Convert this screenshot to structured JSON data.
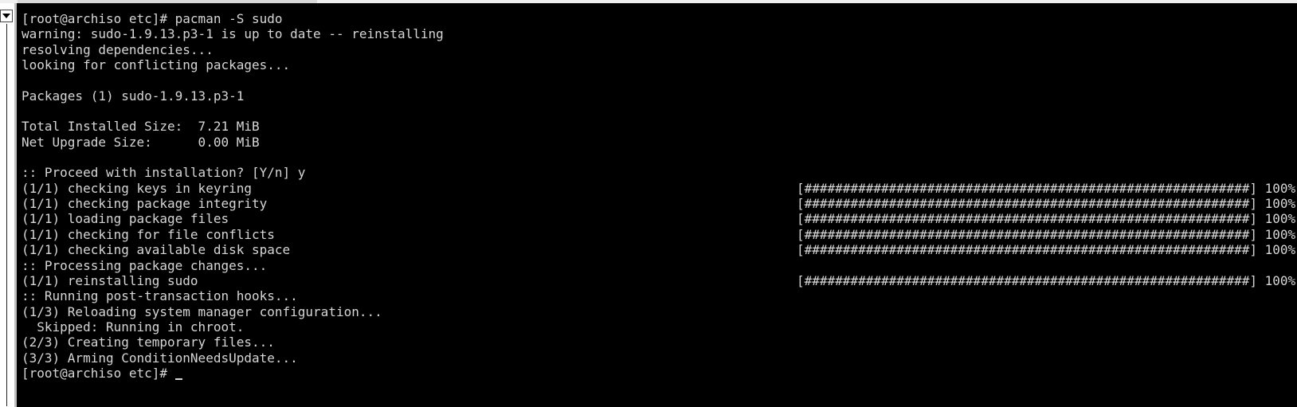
{
  "terminal": {
    "lines": [
      {
        "text": "[root@archiso etc]# pacman -S sudo",
        "bar": ""
      },
      {
        "text": "warning: sudo-1.9.13.p3-1 is up to date -- reinstalling",
        "bar": ""
      },
      {
        "text": "resolving dependencies...",
        "bar": ""
      },
      {
        "text": "looking for conflicting packages...",
        "bar": ""
      },
      {
        "text": "",
        "bar": ""
      },
      {
        "text": "Packages (1) sudo-1.9.13.p3-1",
        "bar": ""
      },
      {
        "text": "",
        "bar": ""
      },
      {
        "text": "Total Installed Size:  7.21 MiB",
        "bar": ""
      },
      {
        "text": "Net Upgrade Size:      0.00 MiB",
        "bar": ""
      },
      {
        "text": "",
        "bar": ""
      },
      {
        "text": ":: Proceed with installation? [Y/n] y",
        "bar": ""
      },
      {
        "text": "(1/1) checking keys in keyring",
        "bar": "[##########################################################] 100%"
      },
      {
        "text": "(1/1) checking package integrity",
        "bar": "[##########################################################] 100%"
      },
      {
        "text": "(1/1) loading package files",
        "bar": "[##########################################################] 100%"
      },
      {
        "text": "(1/1) checking for file conflicts",
        "bar": "[##########################################################] 100%"
      },
      {
        "text": "(1/1) checking available disk space",
        "bar": "[##########################################################] 100%"
      },
      {
        "text": ":: Processing package changes...",
        "bar": ""
      },
      {
        "text": "(1/1) reinstalling sudo",
        "bar": "[##########################################################] 100%"
      },
      {
        "text": ":: Running post-transaction hooks...",
        "bar": ""
      },
      {
        "text": "(1/3) Reloading system manager configuration...",
        "bar": ""
      },
      {
        "text": "  Skipped: Running in chroot.",
        "bar": ""
      },
      {
        "text": "(2/3) Creating temporary files...",
        "bar": ""
      },
      {
        "text": "(3/3) Arming ConditionNeedsUpdate...",
        "bar": ""
      },
      {
        "text": "[root@archiso etc]# ",
        "bar": ""
      }
    ]
  },
  "colors": {
    "background": "#000000",
    "foreground": "#d6d6d6"
  },
  "icons": {
    "scroll_button": "chevron-down-icon"
  }
}
